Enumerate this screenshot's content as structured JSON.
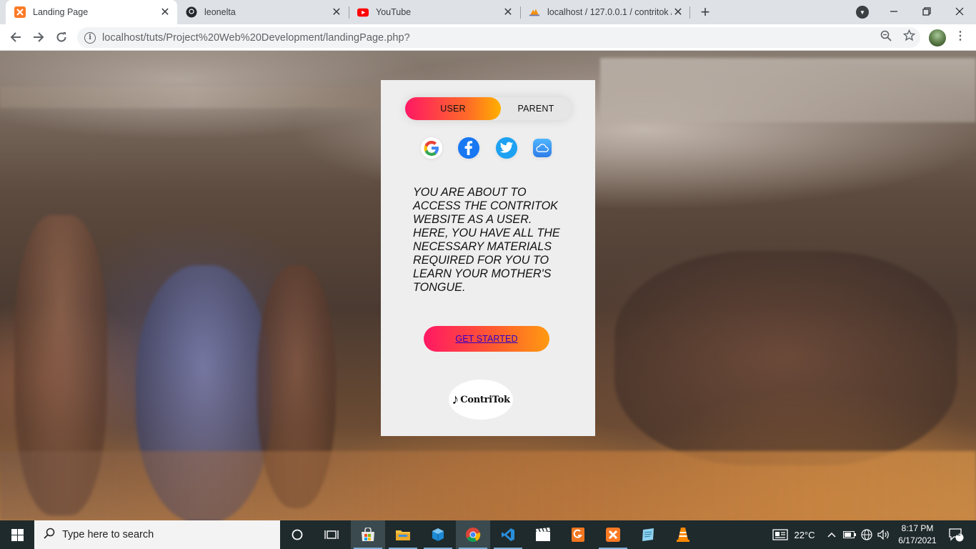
{
  "browser": {
    "tabs": [
      {
        "title": "Landing Page",
        "favicon": "xampp-icon",
        "active": true
      },
      {
        "title": "leonelta",
        "favicon": "github-icon",
        "active": false
      },
      {
        "title": "YouTube",
        "favicon": "youtube-icon",
        "active": false
      },
      {
        "title": "localhost / 127.0.0.1 / contritok /",
        "favicon": "phpmyadmin-icon",
        "active": false
      }
    ],
    "url": "localhost/tuts/Project%20Web%20Development/landingPage.php?"
  },
  "page": {
    "toggle": {
      "user_label": "USER",
      "parent_label": "PARENT"
    },
    "social": [
      "google-icon",
      "facebook-icon",
      "twitter-icon",
      "icloud-icon"
    ],
    "message": "YOU ARE ABOUT TO ACCESS THE CONTRITOK WEBSITE AS A USER. HERE, YOU HAVE ALL THE NECESSARY MATERIALS REQUIRED FOR YOU TO LEARN YOUR MOTHER'S TONGUE.",
    "cta_label": "GET STARTED",
    "logo_text": "ContriTok"
  },
  "taskbar": {
    "search_placeholder": "Type here to search",
    "weather": "22°C",
    "time": "8:17 PM",
    "date": "6/17/2021",
    "notifications": "2"
  },
  "colors": {
    "accent_start": "#ff1864",
    "accent_end": "#ffb000",
    "card_bg": "#eeeeee",
    "taskbar_bg": "#1f2a2c"
  }
}
